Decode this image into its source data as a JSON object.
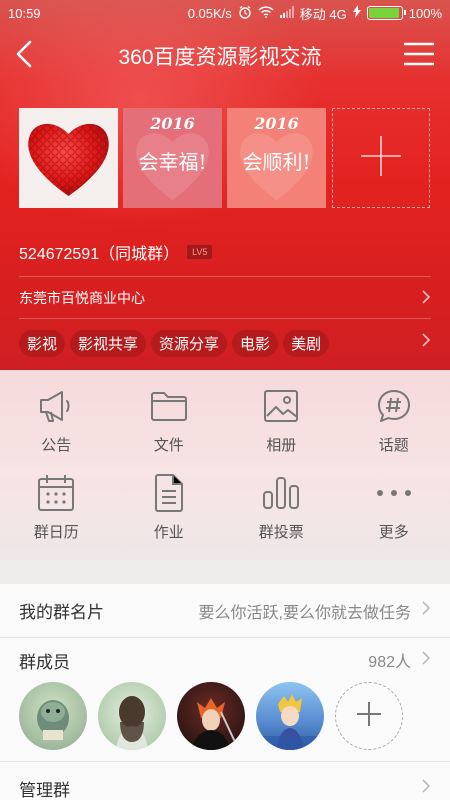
{
  "statusbar": {
    "time": "10:59",
    "speed": "0.05K/s",
    "carrier": "移动 4G",
    "battery": "100%",
    "battery_level": 1.0
  },
  "navbar": {
    "title": "360百度资源影视交流"
  },
  "photos": [
    {
      "type": "heart"
    },
    {
      "year": "2016",
      "phrase": "会幸福!"
    },
    {
      "year": "2016",
      "phrase": "会顺利!"
    }
  ],
  "group": {
    "id_text": "524672591（同城群）",
    "level_badge": "LV5",
    "location": "东莞市百悦商业中心",
    "tags": [
      "影视",
      "影视共享",
      "资源分享",
      "电影",
      "美剧"
    ]
  },
  "features": [
    {
      "label": "公告",
      "icon": "megaphone-icon"
    },
    {
      "label": "文件",
      "icon": "folder-icon"
    },
    {
      "label": "相册",
      "icon": "image-icon"
    },
    {
      "label": "话题",
      "icon": "hashtag-bubble-icon"
    },
    {
      "label": "群日历",
      "icon": "calendar-icon"
    },
    {
      "label": "作业",
      "icon": "document-icon"
    },
    {
      "label": "群投票",
      "icon": "bar-chart-icon"
    },
    {
      "label": "更多",
      "icon": "more-dots-icon"
    }
  ],
  "card": {
    "title": "我的群名片",
    "value": "要么你活跃,要么你就去做任务"
  },
  "members": {
    "title": "群成员",
    "count": "982人"
  },
  "manage": {
    "title": "管理群"
  },
  "colors": {
    "header_red": "#e3221f",
    "tag_bg": "#b51b1d",
    "battery_green": "#7bd33c"
  }
}
